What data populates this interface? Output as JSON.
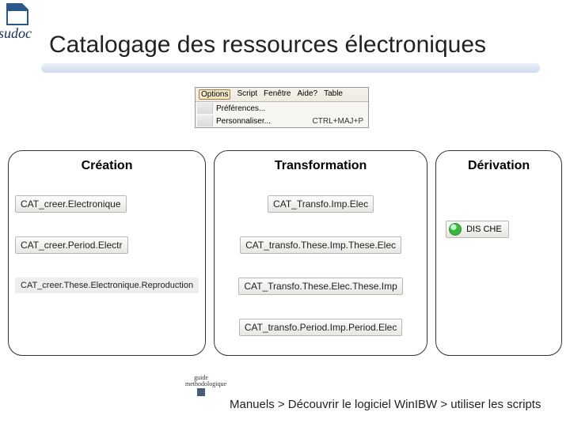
{
  "logo_text": "sudoc",
  "title": "Catalogage des ressources électroniques",
  "menubar": {
    "items": [
      "Options",
      "Script",
      "Fenêtre",
      "Aide?",
      "Table"
    ],
    "active_index": 0,
    "dropdown": [
      {
        "label": "Préférences...",
        "shortcut": ""
      },
      {
        "label": "Personnaliser...",
        "shortcut": "CTRL+MAJ+P"
      }
    ]
  },
  "columns": {
    "creation": {
      "title": "Création",
      "buttons": [
        "CAT_creer.Electronique",
        "CAT_creer.Period.Electr",
        "CAT_creer.These.Electronique.Reproduction"
      ]
    },
    "transformation": {
      "title": "Transformation",
      "buttons": [
        "CAT_Transfo.Imp.Elec",
        "CAT_transfo.These.Imp.These.Elec",
        "CAT_Transfo.These.Elec.These.Imp",
        "CAT_transfo.Period.Imp.Period.Elec"
      ]
    },
    "derivation": {
      "title": "Dérivation",
      "dische_label": "DIS CHE"
    }
  },
  "footer": {
    "logo_text": "guide\nmethodologique",
    "path": "Manuels > Découvrir le logiciel WinIBW > utiliser les scripts"
  }
}
